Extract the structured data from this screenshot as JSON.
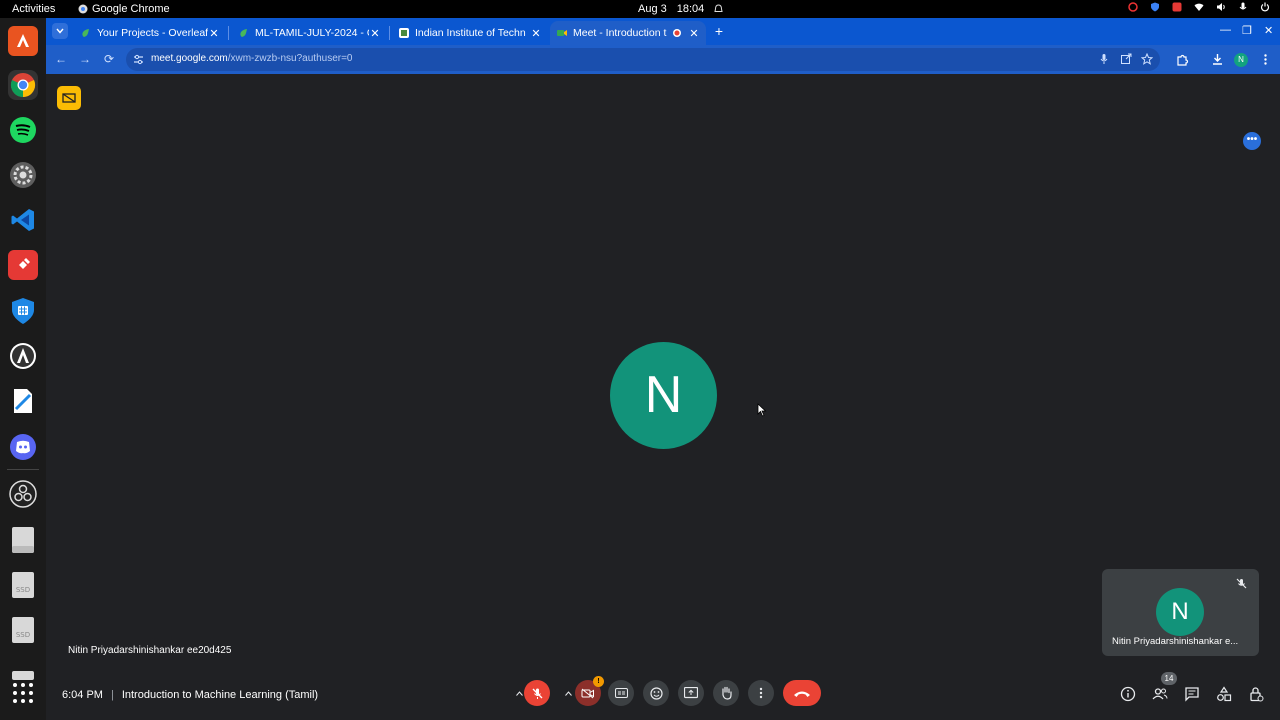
{
  "topbar": {
    "activities": "Activities",
    "app_name": "Google Chrome",
    "date": "Aug 3",
    "time": "18:04"
  },
  "tabs": [
    {
      "title": "Your Projects - Overleaf",
      "icon": "overleaf-icon",
      "active": false
    },
    {
      "title": "ML-TAMIL-JULY-2024 - O",
      "icon": "overleaf-icon",
      "active": false
    },
    {
      "title": "Indian Institute of Techn",
      "icon": "iit-icon",
      "active": false
    },
    {
      "title": "Meet - Introduction t",
      "icon": "meet-icon",
      "active": true
    }
  ],
  "address_bar": {
    "host": "meet.google.com",
    "path": "/xwm-zwzb-nsu?authuser=0"
  },
  "profile_initial": "N",
  "meet": {
    "main_initial": "N",
    "main_name": "Nitin Priyadarshinishankar ee20d425",
    "self_tile": {
      "initial": "N",
      "name": "Nitin Priyadarshinishankar e..."
    },
    "time": "6:04 PM",
    "separator": "|",
    "meeting_title": "Introduction to Machine Learning (Tamil)",
    "camera_alert": "!",
    "participants_count": "14"
  },
  "colors": {
    "accent_blue": "#0b57d0",
    "meet_bg": "#202124",
    "avatar_green": "#12937a",
    "danger_red": "#ea4335",
    "rec_yellow": "#fbbc04"
  }
}
